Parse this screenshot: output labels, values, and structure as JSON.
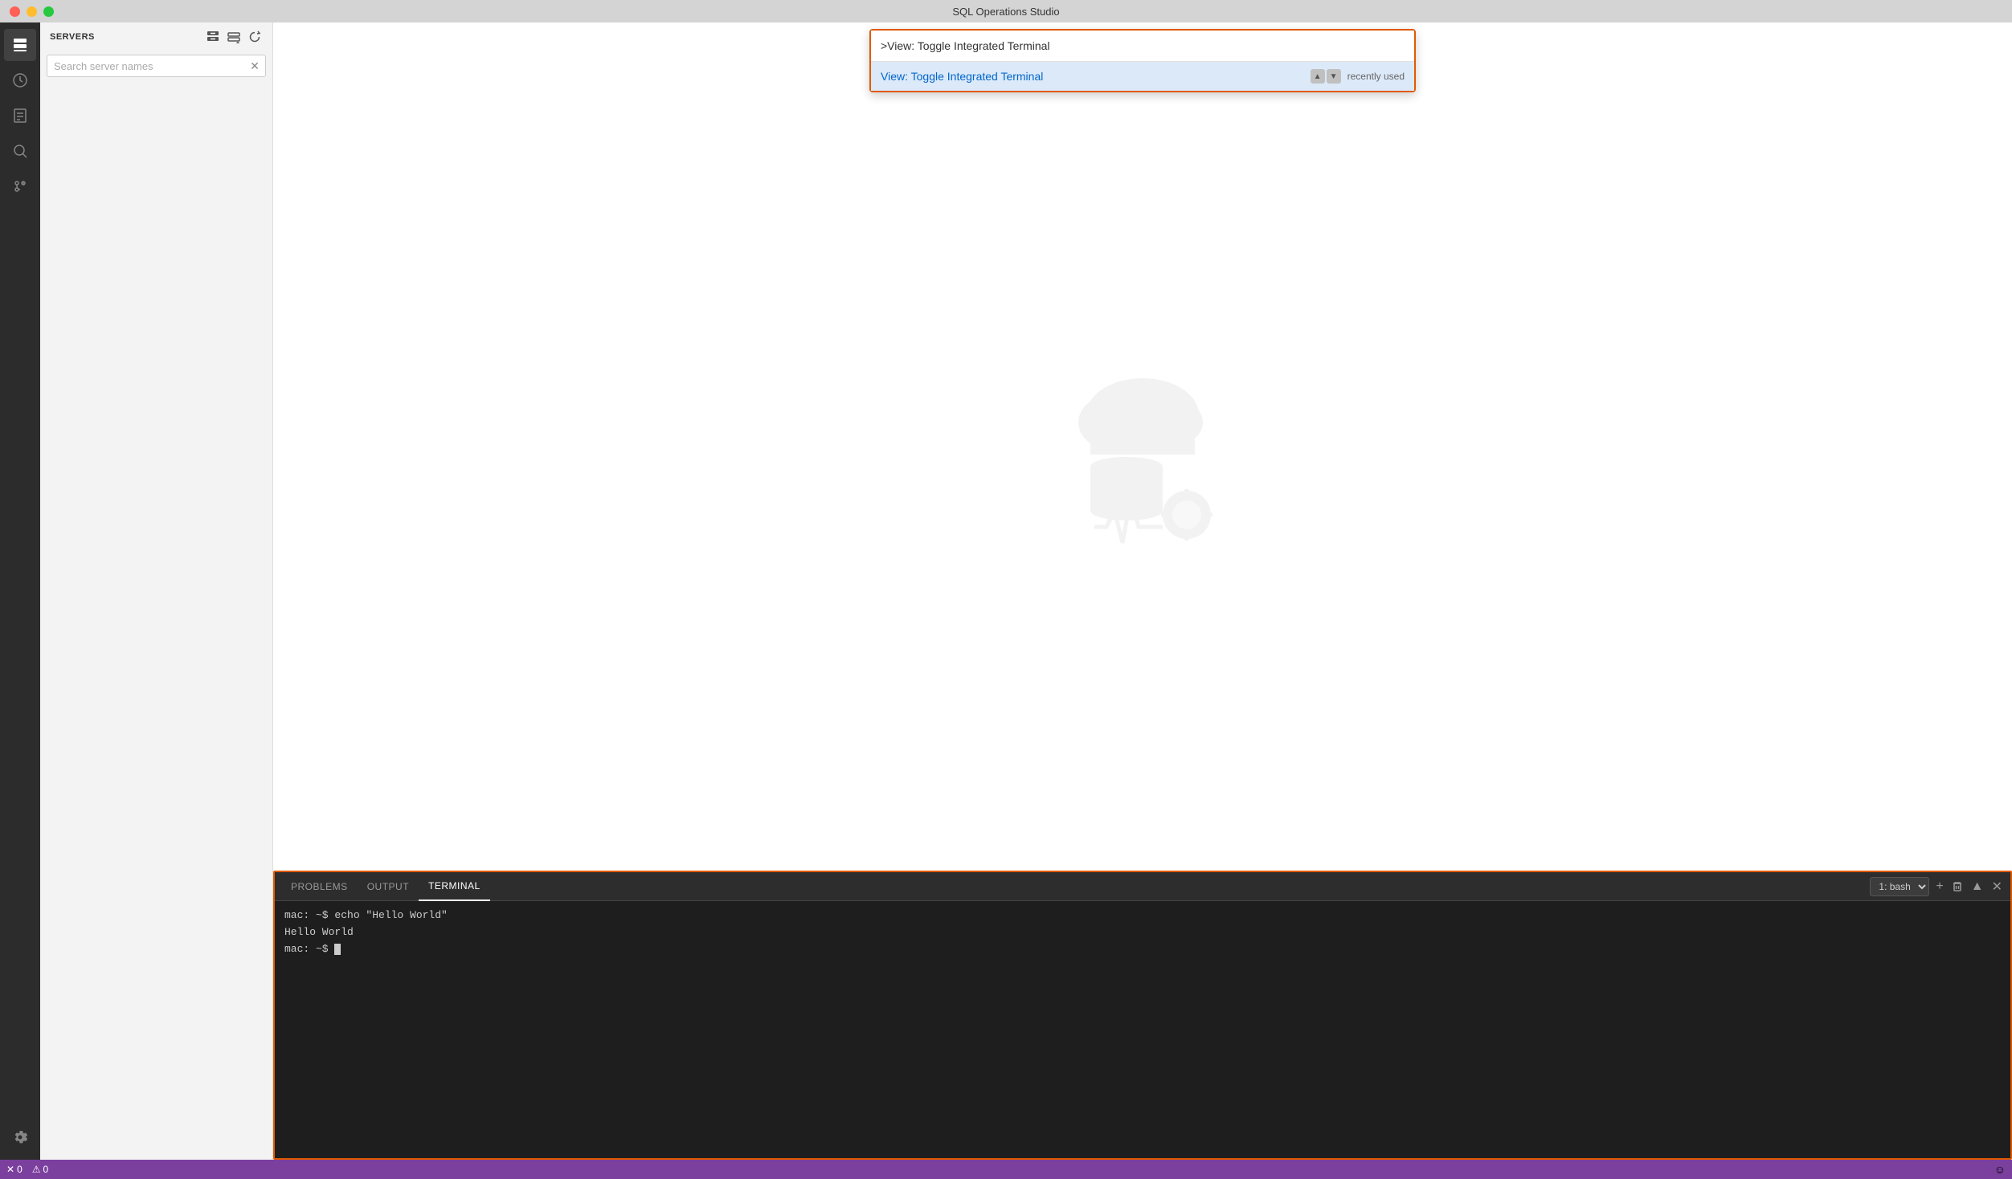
{
  "titlebar": {
    "title": "SQL Operations Studio"
  },
  "activityBar": {
    "icons": [
      {
        "name": "servers-icon",
        "symbol": "⊟",
        "tooltip": "Servers",
        "active": true
      },
      {
        "name": "history-icon",
        "symbol": "○",
        "tooltip": "History",
        "active": false
      },
      {
        "name": "document-icon",
        "symbol": "☐",
        "tooltip": "New Query",
        "active": false
      },
      {
        "name": "search-icon",
        "symbol": "⌕",
        "tooltip": "Search",
        "active": false
      },
      {
        "name": "git-icon",
        "symbol": "⑂",
        "tooltip": "Git",
        "active": false
      }
    ],
    "settingsIcon": {
      "name": "settings-icon",
      "symbol": "⚙",
      "tooltip": "Settings"
    }
  },
  "sidebar": {
    "title": "SERVERS",
    "searchPlaceholder": "Search server names",
    "actions": [
      {
        "name": "new-connection-icon",
        "symbol": "⊕",
        "tooltip": "New Connection"
      },
      {
        "name": "add-server-group-icon",
        "symbol": "⊞",
        "tooltip": "Add Server Group"
      },
      {
        "name": "refresh-icon",
        "symbol": "↺",
        "tooltip": "Refresh"
      }
    ]
  },
  "commandPalette": {
    "inputValue": ">View: Toggle Integrated Terminal",
    "suggestion": {
      "text": "View: Toggle Integrated Terminal",
      "label": "recently used"
    }
  },
  "bottomPanel": {
    "tabs": [
      {
        "name": "tab-problems",
        "label": "PROBLEMS",
        "active": false
      },
      {
        "name": "tab-output",
        "label": "OUTPUT",
        "active": false
      },
      {
        "name": "tab-terminal",
        "label": "TERMINAL",
        "active": true
      }
    ],
    "terminalSelector": "1: bash",
    "terminalLines": [
      {
        "text": "mac: ~$ echo \"Hello World\""
      },
      {
        "text": "Hello World"
      },
      {
        "text": "mac: ~$ "
      }
    ]
  },
  "statusBar": {
    "errors": "0",
    "warnings": "0",
    "smileyIcon": "☺"
  }
}
